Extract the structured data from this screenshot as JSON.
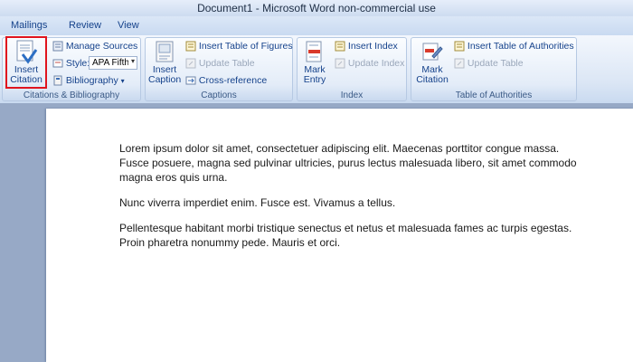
{
  "window": {
    "title": "Document1 - Microsoft Word non-commercial use"
  },
  "tabs": [
    "Mailings",
    "Review",
    "View"
  ],
  "ribbon": {
    "citations": {
      "insert_citation": "Insert\nCitation",
      "manage_sources": "Manage Sources",
      "style_label": "Style:",
      "style_value": "APA Fifth",
      "bibliography": "Bibliography",
      "group_label": "Citations & Bibliography"
    },
    "captions": {
      "insert_caption": "Insert\nCaption",
      "insert_table_of_figures": "Insert Table of Figures",
      "update_table": "Update Table",
      "cross_reference": "Cross-reference",
      "group_label": "Captions"
    },
    "index": {
      "mark_entry": "Mark\nEntry",
      "insert_index": "Insert Index",
      "update_index": "Update Index",
      "group_label": "Index"
    },
    "authorities": {
      "mark_citation": "Mark\nCitation",
      "insert_table_of_authorities": "Insert Table of Authorities",
      "update_table": "Update Table",
      "group_label": "Table of Authorities"
    }
  },
  "document": {
    "paragraphs": [
      "Lorem ipsum dolor sit amet, consectetuer adipiscing elit. Maecenas porttitor congue massa. Fusce posuere, magna sed pulvinar ultricies, purus lectus malesuada libero, sit amet commodo magna eros quis urna.",
      "Nunc viverra imperdiet enim. Fusce est. Vivamus a tellus.",
      "Pellentesque habitant morbi tristique senectus et netus et malesuada fames ac turpis egestas. Proin pharetra nonummy pede. Mauris et orci."
    ]
  },
  "colors": {
    "accent": "#15428b",
    "highlight": "#e0141e",
    "ribbon": "#dbe6f5"
  }
}
